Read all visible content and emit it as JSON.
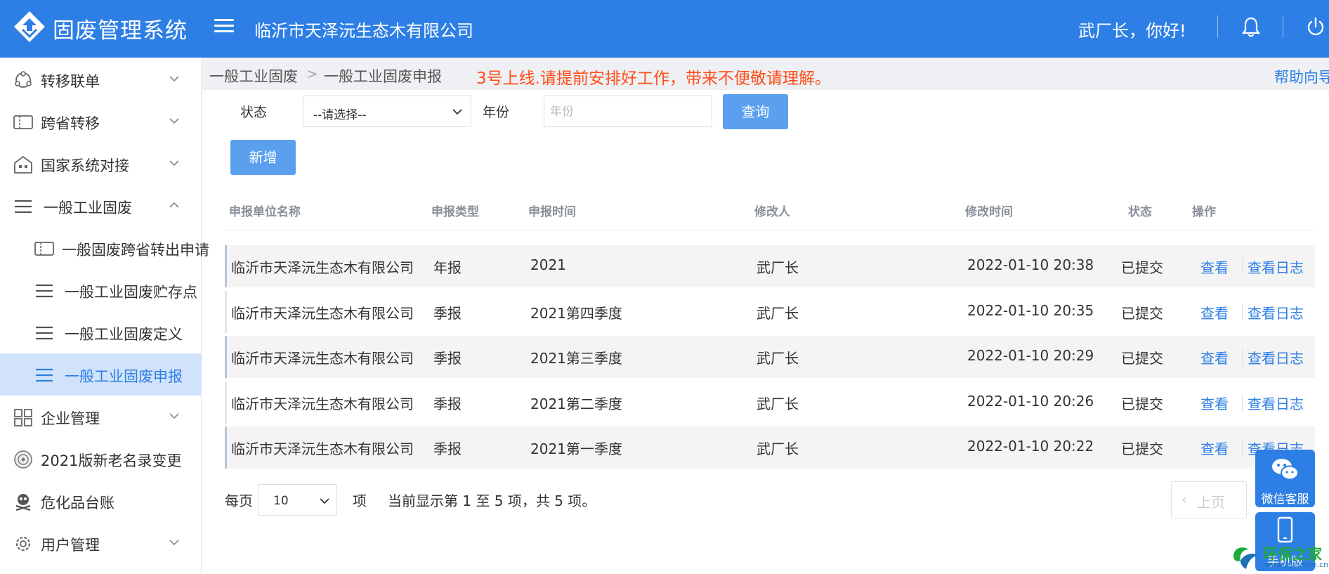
{
  "header": {
    "app_title": "固废管理系统",
    "company": "临沂市天泽沅生态木有限公司",
    "greeting": "武厂长，你好!"
  },
  "sidebar": {
    "items": [
      {
        "label": "转移联单",
        "icon": "transfer-icon"
      },
      {
        "label": "跨省转移",
        "icon": "ticket-icon"
      },
      {
        "label": "国家系统对接",
        "icon": "building-icon"
      },
      {
        "label": "一般工业固废",
        "icon": "list-icon"
      },
      {
        "label": "一般固废跨省转出申请",
        "icon": "ticket-icon"
      },
      {
        "label": "一般工业固废贮存点",
        "icon": "list-icon"
      },
      {
        "label": "一般工业固废定义",
        "icon": "list-icon"
      },
      {
        "label": "一般工业固废申报",
        "icon": "list-icon"
      },
      {
        "label": "企业管理",
        "icon": "grid-icon"
      },
      {
        "label": "2021版新老名录变更",
        "icon": "seal-icon"
      },
      {
        "label": "危化品台账",
        "icon": "skull-icon"
      },
      {
        "label": "用户管理",
        "icon": "gear-icon"
      }
    ]
  },
  "breadcrumb": {
    "items": [
      "一般工业固废",
      "一般工业固废申报"
    ],
    "separator": ">",
    "notice": "3号上线.请提前安排好工作，带来不便敬请理解。",
    "help": "帮助向导"
  },
  "filter": {
    "status_label": "状态",
    "status_value": "--请选择--",
    "year_label": "年份",
    "year_placeholder": "年份",
    "query_label": "查询",
    "add_label": "新增"
  },
  "table": {
    "columns": [
      "申报单位名称",
      "申报类型",
      "申报时间",
      "修改人",
      "修改时间",
      "状态",
      "操作"
    ],
    "rows": [
      {
        "unit": "临沂市天泽沅生态木有限公司",
        "type": "年报",
        "time": "2021",
        "modifier": "武厂长",
        "modified": "2022-01-10 20:38",
        "status": "已提交"
      },
      {
        "unit": "临沂市天泽沅生态木有限公司",
        "type": "季报",
        "time": "2021第四季度",
        "modifier": "武厂长",
        "modified": "2022-01-10 20:35",
        "status": "已提交"
      },
      {
        "unit": "临沂市天泽沅生态木有限公司",
        "type": "季报",
        "time": "2021第三季度",
        "modifier": "武厂长",
        "modified": "2022-01-10 20:29",
        "status": "已提交"
      },
      {
        "unit": "临沂市天泽沅生态木有限公司",
        "type": "季报",
        "time": "2021第二季度",
        "modifier": "武厂长",
        "modified": "2022-01-10 20:26",
        "status": "已提交"
      },
      {
        "unit": "临沂市天泽沅生态木有限公司",
        "type": "季报",
        "time": "2021第一季度",
        "modifier": "武厂长",
        "modified": "2022-01-10 20:22",
        "status": "已提交"
      }
    ],
    "action_view": "查看",
    "action_log": "查看日志"
  },
  "pagination": {
    "per_page_label": "每页",
    "per_page_value": "10",
    "unit_label": "项",
    "summary": "当前显示第 1 至 5 项，共 5 项。",
    "prev_label": "上页"
  },
  "widgets": {
    "wechat_label": "微信客服",
    "mobile_label": "手机版"
  },
  "watermark": {
    "text": "环保之家",
    "url": "www.hj-home.cn"
  },
  "colors": {
    "brand": "#2e7fe5",
    "notice": "#ff4d1a",
    "active_bg": "#d0e3fa"
  }
}
